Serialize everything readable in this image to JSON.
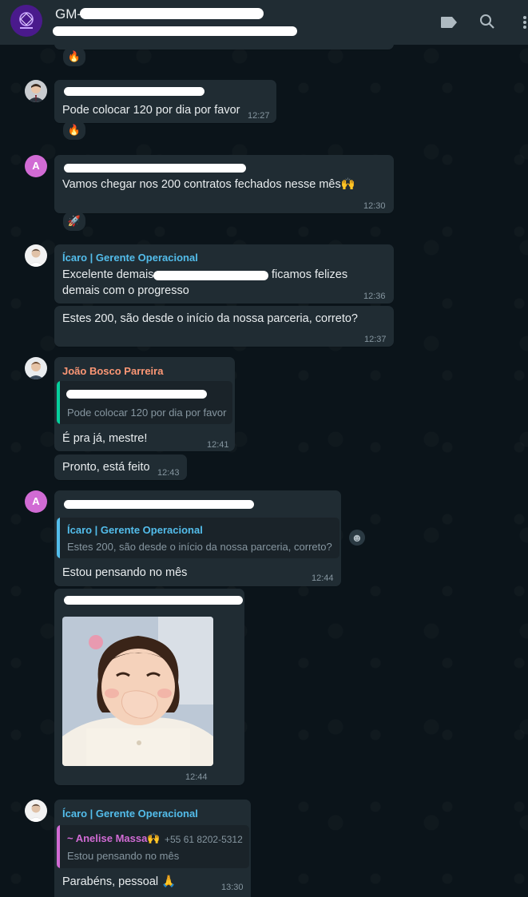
{
  "header": {
    "title_visible": "GM-"
  },
  "messages": [
    {
      "id": "m0",
      "reaction": "🔥"
    },
    {
      "id": "m1",
      "text": "Pode colocar 120 por dia por favor",
      "time": "12:27",
      "reaction": "🔥"
    },
    {
      "id": "m2",
      "avatar_letter": "A",
      "text": "Vamos chegar nos 200 contratos fechados nesse mês🙌",
      "time": "12:30",
      "reaction": "🚀"
    },
    {
      "id": "m3",
      "sender": "Ícaro | Gerente Operacional",
      "text_line1_start": "Excelente demais",
      "text_line1_end": "ficamos felizes",
      "text_line2": "demais com o progresso",
      "time": "12:36"
    },
    {
      "id": "m4",
      "text": "Estes 200, são desde o início da nossa parceria, correto?",
      "time": "12:37"
    },
    {
      "id": "m5",
      "sender": "João Bosco Parreira",
      "quote_text": "Pode colocar 120 por dia por favor",
      "text": "É pra já, mestre!",
      "time": "12:41"
    },
    {
      "id": "m6",
      "text": "Pronto, está feito",
      "time": "12:43"
    },
    {
      "id": "m7",
      "avatar_letter": "A",
      "quote_name": "Ícaro | Gerente Operacional",
      "quote_text": "Estes 200, são desde o início da nossa parceria, correto?",
      "text": "Estou pensando no mês",
      "time": "12:44",
      "react_button": "☻"
    },
    {
      "id": "m8",
      "time": "12:44"
    },
    {
      "id": "m9",
      "sender": "Ícaro | Gerente Operacional",
      "quote_name": "~ Anelise Massa🙌",
      "quote_phone": "+55 61 8202-5312",
      "quote_text": "Estou pensando no mês",
      "text": "Parabéns, pessoal 🙏",
      "time": "13:30"
    }
  ],
  "colors": {
    "background": "#0b141a",
    "bubble": "#202c33",
    "header": "#202c33",
    "icaro": "#53bdeb",
    "joao": "#fc9775",
    "anelise": "#d16bd4",
    "quote_green": "#06cf9c",
    "timestamp": "#8696a0"
  },
  "icons": [
    "group-avatar-icon",
    "label-icon",
    "search-icon",
    "menu-dots-icon"
  ]
}
